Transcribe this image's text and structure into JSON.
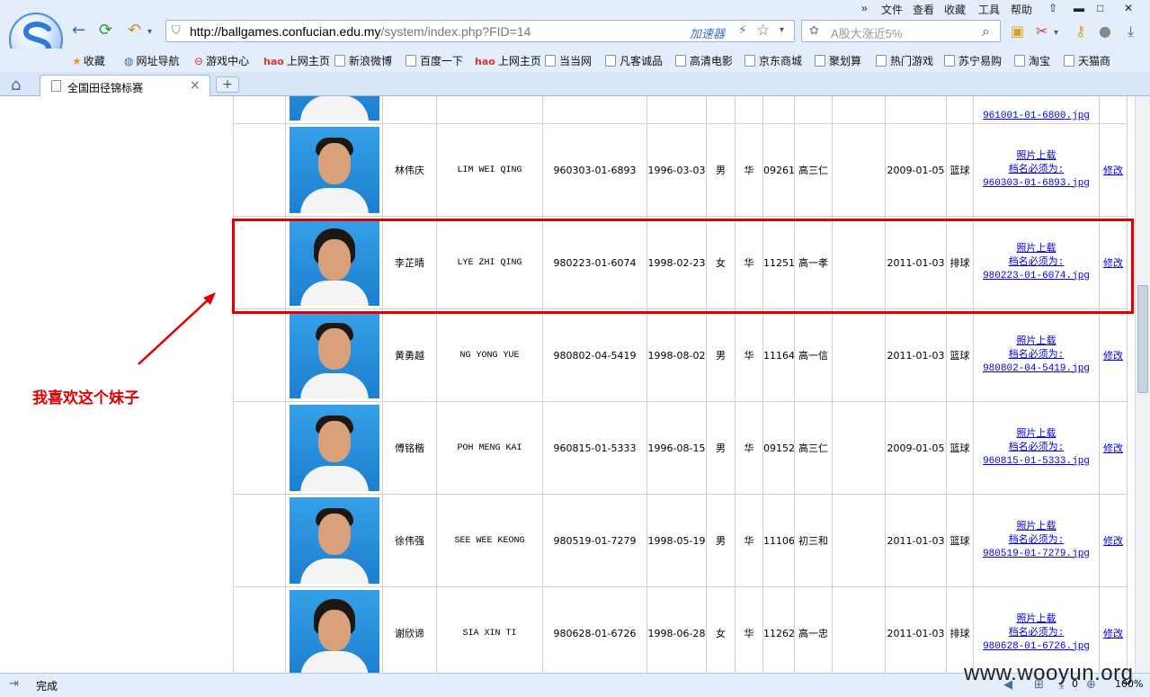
{
  "browser": {
    "menu": [
      "文件",
      "查看",
      "收藏",
      "工具",
      "帮助"
    ],
    "url_host": "http://ballgames.confucian.edu.my",
    "url_path": "/system/index.php?FID=14",
    "accelerator": "加速器",
    "search_placeholder": "A股大涨近5%",
    "bookmarks": [
      "收藏",
      "网址导航",
      "游戏中心",
      "上网主页",
      "新浪微博",
      "百度一下",
      "上网主页",
      "当当网",
      "凡客诚品",
      "高清电影",
      "京东商城",
      "聚划算",
      "热门游戏",
      "苏宁易购",
      "淘宝",
      "天猫商"
    ],
    "tab_title": "全国田径锦标赛",
    "status": "完成",
    "status_count": "0",
    "zoom": "100%"
  },
  "rows": [
    {
      "name": "",
      "roman": "",
      "ic": "",
      "dob": "",
      "sex": "",
      "race": "",
      "id": "",
      "class": "",
      "date": "",
      "sport": "",
      "upload": "",
      "mustname": "",
      "file": "961001-01-6800.jpg",
      "edit": "",
      "photo": "m"
    },
    {
      "name": "林伟庆",
      "roman": "LIM WEI QING",
      "ic": "960303-01-6893",
      "dob": "1996-03-03",
      "sex": "男",
      "race": "华",
      "id": "09261",
      "class": "高三仁",
      "date": "2009-01-05",
      "sport": "篮球",
      "upload": "照片上载",
      "mustname": "档名必须为:",
      "file": "960303-01-6893.jpg",
      "edit": "修改",
      "photo": "m"
    },
    {
      "name": "李芷晴",
      "roman": "LYE ZHI QING",
      "ic": "980223-01-6074",
      "dob": "1998-02-23",
      "sex": "女",
      "race": "华",
      "id": "11251",
      "class": "高一孝",
      "date": "2011-01-03",
      "sport": "排球",
      "upload": "照片上载",
      "mustname": "档名必须为:",
      "file": "980223-01-6074.jpg",
      "edit": "修改",
      "photo": "f"
    },
    {
      "name": "黄勇越",
      "roman": "NG YONG YUE",
      "ic": "980802-04-5419",
      "dob": "1998-08-02",
      "sex": "男",
      "race": "华",
      "id": "11164",
      "class": "高一信",
      "date": "2011-01-03",
      "sport": "篮球",
      "upload": "照片上载",
      "mustname": "档名必须为:",
      "file": "980802-04-5419.jpg",
      "edit": "修改",
      "photo": "m"
    },
    {
      "name": "傅铭楷",
      "roman": "POH MENG KAI",
      "ic": "960815-01-5333",
      "dob": "1996-08-15",
      "sex": "男",
      "race": "华",
      "id": "09152",
      "class": "高三仁",
      "date": "2009-01-05",
      "sport": "篮球",
      "upload": "照片上载",
      "mustname": "档名必须为:",
      "file": "960815-01-5333.jpg",
      "edit": "修改",
      "photo": "m"
    },
    {
      "name": "徐伟强",
      "roman": "SEE WEE KEONG",
      "ic": "980519-01-7279",
      "dob": "1998-05-19",
      "sex": "男",
      "race": "华",
      "id": "11106",
      "class": "初三和",
      "date": "2011-01-03",
      "sport": "篮球",
      "upload": "照片上载",
      "mustname": "档名必须为:",
      "file": "980519-01-7279.jpg",
      "edit": "修改",
      "photo": "m"
    },
    {
      "name": "谢欣谛",
      "roman": "SIA XIN TI",
      "ic": "980628-01-6726",
      "dob": "1998-06-28",
      "sex": "女",
      "race": "华",
      "id": "11262",
      "class": "高一忠",
      "date": "2011-01-03",
      "sport": "排球",
      "upload": "照片上载",
      "mustname": "档名必须为:",
      "file": "980628-01-6726.jpg",
      "edit": "修改",
      "photo": "f"
    }
  ],
  "annotation": {
    "text": "我喜欢这个妹子",
    "color": "#e00000"
  },
  "watermark": "www.wooyun.org",
  "colors": {
    "highlight": "#e00000",
    "link": "#0000ee",
    "chrome": "#e4eefb",
    "photo_bg": "#2b90dd"
  }
}
